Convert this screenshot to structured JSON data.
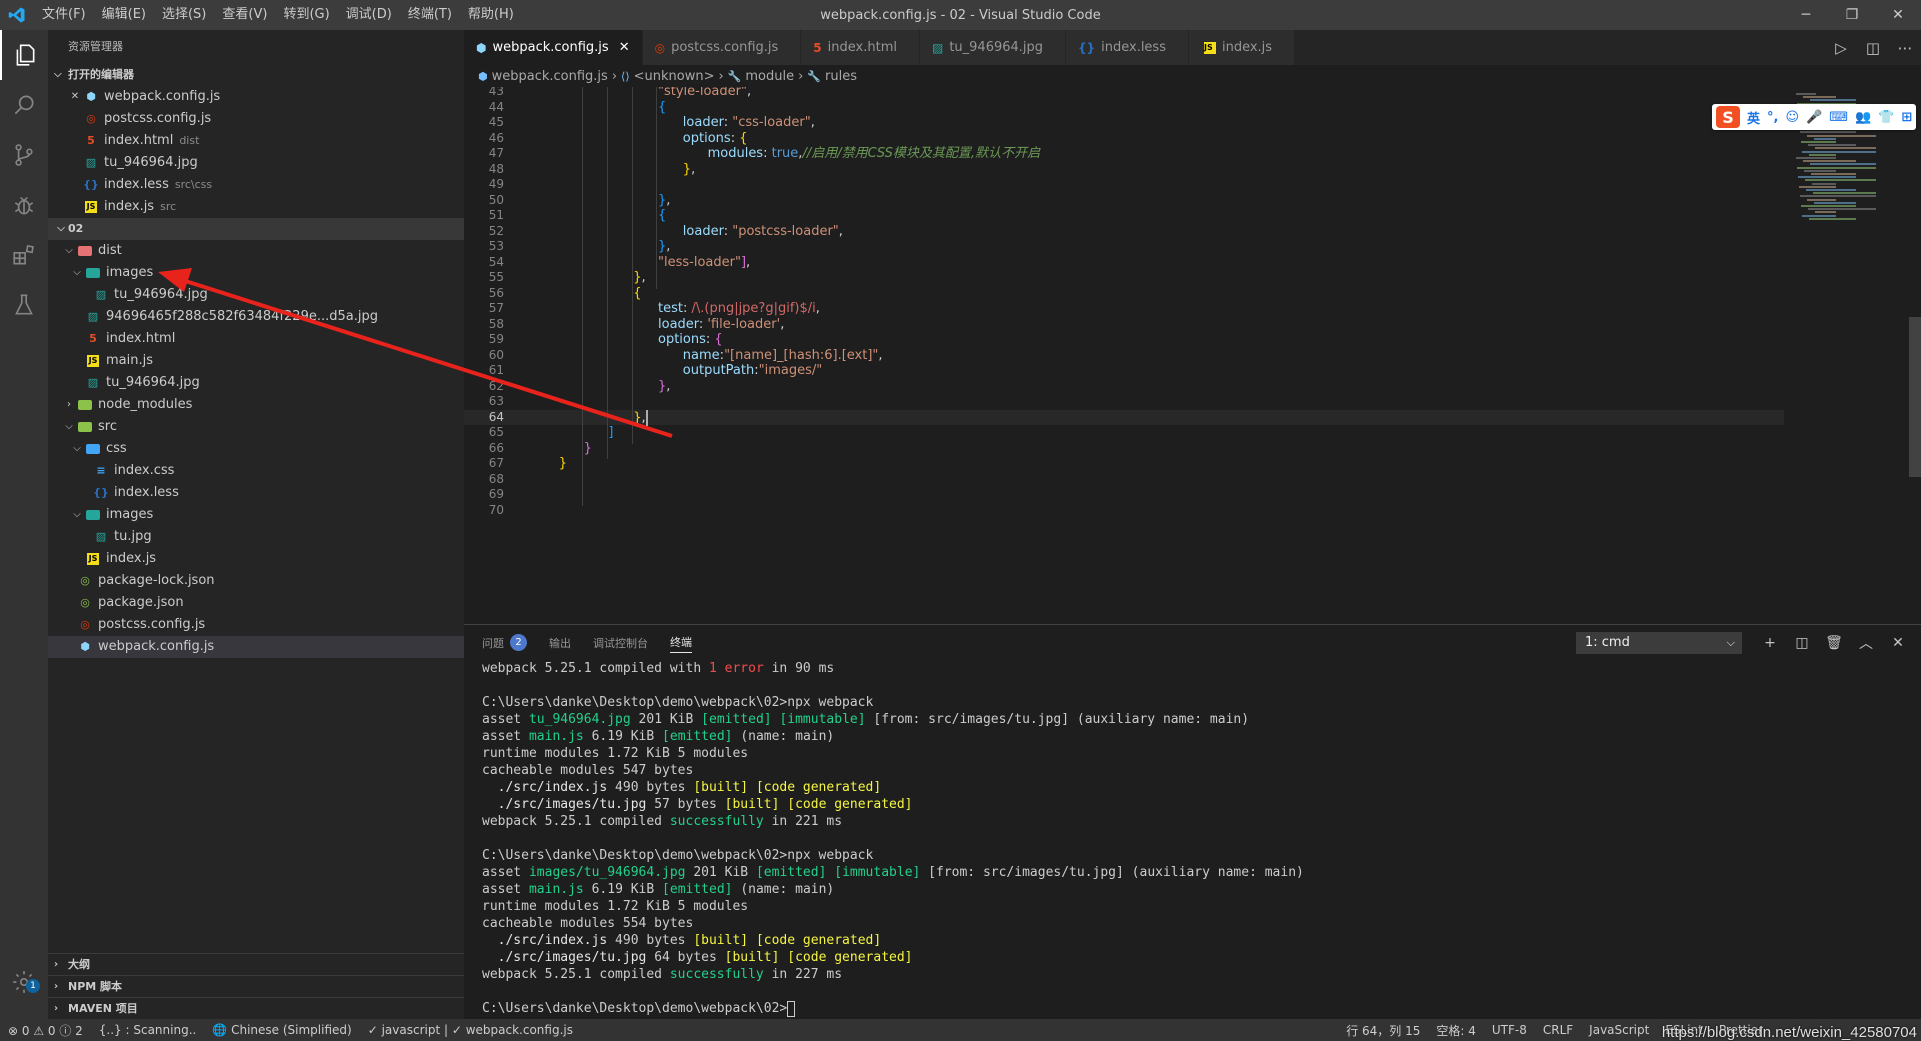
{
  "titlebar": {
    "logo": "◀",
    "menus": [
      "文件(F)",
      "编辑(E)",
      "选择(S)",
      "查看(V)",
      "转到(G)",
      "调试(D)",
      "终端(T)",
      "帮助(H)"
    ],
    "window_title": "webpack.config.js - 02 - Visual Studio Code"
  },
  "activity": {
    "items": [
      "explorer-icon",
      "search-icon",
      "source-control-icon",
      "debug-icon",
      "extensions-icon",
      "test-icon"
    ],
    "settings_badge": "1"
  },
  "sidebar": {
    "title": "资源管理器",
    "open_editors_label": "打开的编辑器",
    "open_editors": [
      {
        "name": "webpack.config.js",
        "desc": "",
        "icon": "webpack"
      },
      {
        "name": "postcss.config.js",
        "desc": "",
        "icon": "postcss"
      },
      {
        "name": "index.html",
        "desc": "dist",
        "icon": "html"
      },
      {
        "name": "tu_946964.jpg",
        "desc": "",
        "icon": "image"
      },
      {
        "name": "index.less",
        "desc": "src\\css",
        "icon": "less"
      },
      {
        "name": "index.js",
        "desc": "src",
        "icon": "js"
      }
    ],
    "project_label": "02",
    "tree": [
      {
        "name": "dist",
        "depth": 1,
        "type": "folder",
        "color": "red",
        "open": true
      },
      {
        "name": "images",
        "depth": 2,
        "type": "folder",
        "color": "teal",
        "open": true
      },
      {
        "name": "tu_946964.jpg",
        "depth": 3,
        "type": "image"
      },
      {
        "name": "94696465f288c582f63484f229e...d5a.jpg",
        "depth": 2,
        "type": "image"
      },
      {
        "name": "index.html",
        "depth": 2,
        "type": "html"
      },
      {
        "name": "main.js",
        "depth": 2,
        "type": "js"
      },
      {
        "name": "tu_946964.jpg",
        "depth": 2,
        "type": "image"
      },
      {
        "name": "node_modules",
        "depth": 1,
        "type": "folder",
        "color": "green",
        "open": false
      },
      {
        "name": "src",
        "depth": 1,
        "type": "folder",
        "color": "green",
        "open": true
      },
      {
        "name": "css",
        "depth": 2,
        "type": "folder",
        "color": "blue",
        "open": true
      },
      {
        "name": "index.css",
        "depth": 3,
        "type": "css"
      },
      {
        "name": "index.less",
        "depth": 3,
        "type": "less"
      },
      {
        "name": "images",
        "depth": 2,
        "type": "folder",
        "color": "teal",
        "open": true
      },
      {
        "name": "tu.jpg",
        "depth": 3,
        "type": "image"
      },
      {
        "name": "index.js",
        "depth": 2,
        "type": "js"
      },
      {
        "name": "package-lock.json",
        "depth": 1,
        "type": "json"
      },
      {
        "name": "package.json",
        "depth": 1,
        "type": "json"
      },
      {
        "name": "postcss.config.js",
        "depth": 1,
        "type": "postcss"
      },
      {
        "name": "webpack.config.js",
        "depth": 1,
        "type": "webpack",
        "selected": true
      }
    ],
    "bottom_sections": [
      "大纲",
      "NPM 脚本",
      "MAVEN 项目"
    ]
  },
  "tabs": [
    {
      "label": "webpack.config.js",
      "icon": "webpack",
      "active": true
    },
    {
      "label": "postcss.config.js",
      "icon": "postcss",
      "active": false
    },
    {
      "label": "index.html",
      "icon": "html",
      "active": false
    },
    {
      "label": "tu_946964.jpg",
      "icon": "image",
      "active": false
    },
    {
      "label": "index.less",
      "icon": "less",
      "active": false
    },
    {
      "label": "index.js",
      "icon": "js",
      "active": false
    }
  ],
  "breadcrumb": [
    "webpack.config.js",
    "<unknown>",
    "module",
    "rules"
  ],
  "editor": {
    "lines": [
      {
        "n": "43",
        "indent": 5,
        "tokens": [
          [
            "str",
            "\"style-loader\""
          ],
          [
            "p",
            ","
          ]
        ]
      },
      {
        "n": "44",
        "indent": 5,
        "tokens": [
          [
            "br3",
            "{"
          ]
        ]
      },
      {
        "n": "45",
        "indent": 6,
        "tokens": [
          [
            "key",
            "loader"
          ],
          [
            "p",
            ": "
          ],
          [
            "str",
            "\"css-loader\""
          ],
          [
            "p",
            ","
          ]
        ]
      },
      {
        "n": "46",
        "indent": 6,
        "tokens": [
          [
            "key",
            "options"
          ],
          [
            "p",
            ": "
          ],
          [
            "br1",
            "{"
          ]
        ]
      },
      {
        "n": "47",
        "indent": 7,
        "tokens": [
          [
            "key",
            "modules"
          ],
          [
            "p",
            ": "
          ],
          [
            "kw",
            "true"
          ],
          [
            "p",
            ","
          ],
          [
            "cm",
            "//启用/禁用CSS模块及其配置,默认不开启"
          ]
        ]
      },
      {
        "n": "48",
        "indent": 6,
        "tokens": [
          [
            "br1",
            "}"
          ],
          [
            "p",
            ","
          ]
        ]
      },
      {
        "n": "49",
        "indent": 0,
        "tokens": []
      },
      {
        "n": "50",
        "indent": 5,
        "tokens": [
          [
            "br3",
            "}"
          ],
          [
            "p",
            ","
          ]
        ]
      },
      {
        "n": "51",
        "indent": 5,
        "tokens": [
          [
            "br3",
            "{"
          ]
        ]
      },
      {
        "n": "52",
        "indent": 6,
        "tokens": [
          [
            "key",
            "loader"
          ],
          [
            "p",
            ": "
          ],
          [
            "str",
            "\"postcss-loader\""
          ],
          [
            "p",
            ","
          ]
        ]
      },
      {
        "n": "53",
        "indent": 5,
        "tokens": [
          [
            "br3",
            "}"
          ],
          [
            "p",
            ","
          ]
        ]
      },
      {
        "n": "54",
        "indent": 5,
        "tokens": [
          [
            "str",
            "\"less-loader\""
          ],
          [
            "br2",
            "]"
          ],
          [
            "p",
            ","
          ]
        ]
      },
      {
        "n": "55",
        "indent": 4,
        "tokens": [
          [
            "br1",
            "}"
          ],
          [
            "p",
            ","
          ]
        ]
      },
      {
        "n": "56",
        "indent": 4,
        "tokens": [
          [
            "br1",
            "{"
          ]
        ]
      },
      {
        "n": "57",
        "indent": 5,
        "tokens": [
          [
            "key",
            "test"
          ],
          [
            "p",
            ": "
          ],
          [
            "rx",
            "/\\.(png|jpe?g|gif)$/i"
          ],
          [
            "p",
            ","
          ]
        ]
      },
      {
        "n": "58",
        "indent": 5,
        "tokens": [
          [
            "key",
            "loader"
          ],
          [
            "p",
            ": "
          ],
          [
            "str",
            "'file-loader'"
          ],
          [
            "p",
            ","
          ]
        ]
      },
      {
        "n": "59",
        "indent": 5,
        "tokens": [
          [
            "key",
            "options"
          ],
          [
            "p",
            ": "
          ],
          [
            "br2",
            "{"
          ]
        ]
      },
      {
        "n": "60",
        "indent": 6,
        "tokens": [
          [
            "key",
            "name"
          ],
          [
            "p",
            ":"
          ],
          [
            "str",
            "\"[name]_[hash:6].[ext]\""
          ],
          [
            "p",
            ","
          ]
        ]
      },
      {
        "n": "61",
        "indent": 6,
        "tokens": [
          [
            "key",
            "outputPath"
          ],
          [
            "p",
            ":"
          ],
          [
            "str",
            "\"images/\""
          ]
        ]
      },
      {
        "n": "62",
        "indent": 5,
        "tokens": [
          [
            "br2",
            "}"
          ],
          [
            "p",
            ","
          ]
        ]
      },
      {
        "n": "63",
        "indent": 0,
        "tokens": []
      },
      {
        "n": "64",
        "indent": 4,
        "tokens": [
          [
            "br1",
            "}"
          ],
          [
            "p",
            ","
          ]
        ],
        "cursor": true
      },
      {
        "n": "65",
        "indent": 3,
        "tokens": [
          [
            "br3",
            "]"
          ]
        ]
      },
      {
        "n": "66",
        "indent": 2,
        "tokens": [
          [
            "br2",
            "}"
          ]
        ]
      },
      {
        "n": "67",
        "indent": 1,
        "tokens": [
          [
            "br1",
            "}"
          ]
        ]
      },
      {
        "n": "68",
        "indent": 0,
        "tokens": []
      },
      {
        "n": "69",
        "indent": 0,
        "tokens": []
      },
      {
        "n": "70",
        "indent": 0,
        "tokens": []
      }
    ]
  },
  "ime": {
    "logo": "S",
    "items": [
      "英",
      "°,",
      "☺",
      "🎤",
      "⌨",
      "👥",
      "👕",
      "⊞"
    ]
  },
  "panel": {
    "tabs": [
      {
        "label": "问题",
        "badge": "2"
      },
      {
        "label": "输出",
        "badge": ""
      },
      {
        "label": "调试控制台",
        "badge": ""
      },
      {
        "label": "终端",
        "badge": "",
        "active": true
      }
    ],
    "terminal_select": "1: cmd",
    "actions": [
      "+",
      "⧉",
      "🗑",
      "^",
      "✕"
    ],
    "terminal_lines": [
      [
        [
          "",
          "webpack 5.25.1 compiled with "
        ],
        [
          "red",
          "1 error"
        ],
        [
          "",
          " in 90 ms"
        ]
      ],
      [],
      [
        [
          "",
          "C:\\Users\\danke\\Desktop\\demo\\webpack\\02>npx webpack"
        ]
      ],
      [
        [
          "",
          "asset "
        ],
        [
          "green",
          "tu_946964.jpg"
        ],
        [
          "",
          " 201 KiB "
        ],
        [
          "green",
          "[emitted]"
        ],
        [
          "",
          " "
        ],
        [
          "green",
          "[immutable]"
        ],
        [
          "",
          " [from: src/images/tu.jpg] (auxiliary name: main)"
        ]
      ],
      [
        [
          "",
          "asset "
        ],
        [
          "green",
          "main.js"
        ],
        [
          "",
          " 6.19 KiB "
        ],
        [
          "green",
          "[emitted]"
        ],
        [
          "",
          " (name: main)"
        ]
      ],
      [
        [
          "",
          "runtime modules 1.72 KiB 5 modules"
        ]
      ],
      [
        [
          "",
          "cacheable modules 547 bytes"
        ]
      ],
      [
        [
          "wht",
          "  ./src/index.js"
        ],
        [
          "",
          " 490 bytes "
        ],
        [
          "yel",
          "[built] [code generated]"
        ]
      ],
      [
        [
          "wht",
          "  ./src/images/tu.jpg"
        ],
        [
          "",
          " 57 bytes "
        ],
        [
          "yel",
          "[built] [code generated]"
        ]
      ],
      [
        [
          "",
          "webpack 5.25.1 compiled "
        ],
        [
          "green",
          "successfully"
        ],
        [
          "",
          " in 221 ms"
        ]
      ],
      [],
      [
        [
          "",
          "C:\\Users\\danke\\Desktop\\demo\\webpack\\02>npx webpack"
        ]
      ],
      [
        [
          "",
          "asset "
        ],
        [
          "green",
          "images/tu_946964.jpg"
        ],
        [
          "",
          " 201 KiB "
        ],
        [
          "green",
          "[emitted]"
        ],
        [
          "",
          " "
        ],
        [
          "green",
          "[immutable]"
        ],
        [
          "",
          " [from: src/images/tu.jpg] (auxiliary name: main)"
        ]
      ],
      [
        [
          "",
          "asset "
        ],
        [
          "green",
          "main.js"
        ],
        [
          "",
          " 6.19 KiB "
        ],
        [
          "green",
          "[emitted]"
        ],
        [
          "",
          " (name: main)"
        ]
      ],
      [
        [
          "",
          "runtime modules 1.72 KiB 5 modules"
        ]
      ],
      [
        [
          "",
          "cacheable modules 554 bytes"
        ]
      ],
      [
        [
          "wht",
          "  ./src/index.js"
        ],
        [
          "",
          " 490 bytes "
        ],
        [
          "yel",
          "[built] [code generated]"
        ]
      ],
      [
        [
          "wht",
          "  ./src/images/tu.jpg"
        ],
        [
          "",
          " 64 bytes "
        ],
        [
          "yel",
          "[built] [code generated]"
        ]
      ],
      [
        [
          "",
          "webpack 5.25.1 compiled "
        ],
        [
          "green",
          "successfully"
        ],
        [
          "",
          " in 227 ms"
        ]
      ],
      [],
      [
        [
          "",
          "C:\\Users\\danke\\Desktop\\demo\\webpack\\02>"
        ],
        [
          "cursor",
          ""
        ]
      ]
    ]
  },
  "status": {
    "errors": "⊗ 0 ⚠ 0 ⓘ 2",
    "scanning": "{..} : Scanning..",
    "language_pack": "🌐 Chinese (Simplified)",
    "lint_check": "✓ javascript | ✓ webpack.config.js",
    "position": "行 64，列 15",
    "spaces": "空格: 4",
    "encoding": "UTF-8",
    "eol": "CRLF",
    "language": "JavaScript",
    "eslint": "ESLint",
    "prettier": "Prettier"
  },
  "watermark": "https://blog.csdn.net/weixin_42580704",
  "colors": {
    "accent": "#007acc",
    "arrow": "#e8231c",
    "titlebar": "#3c3c3c",
    "sidebar": "#252526",
    "editor": "#1e1e1e"
  }
}
